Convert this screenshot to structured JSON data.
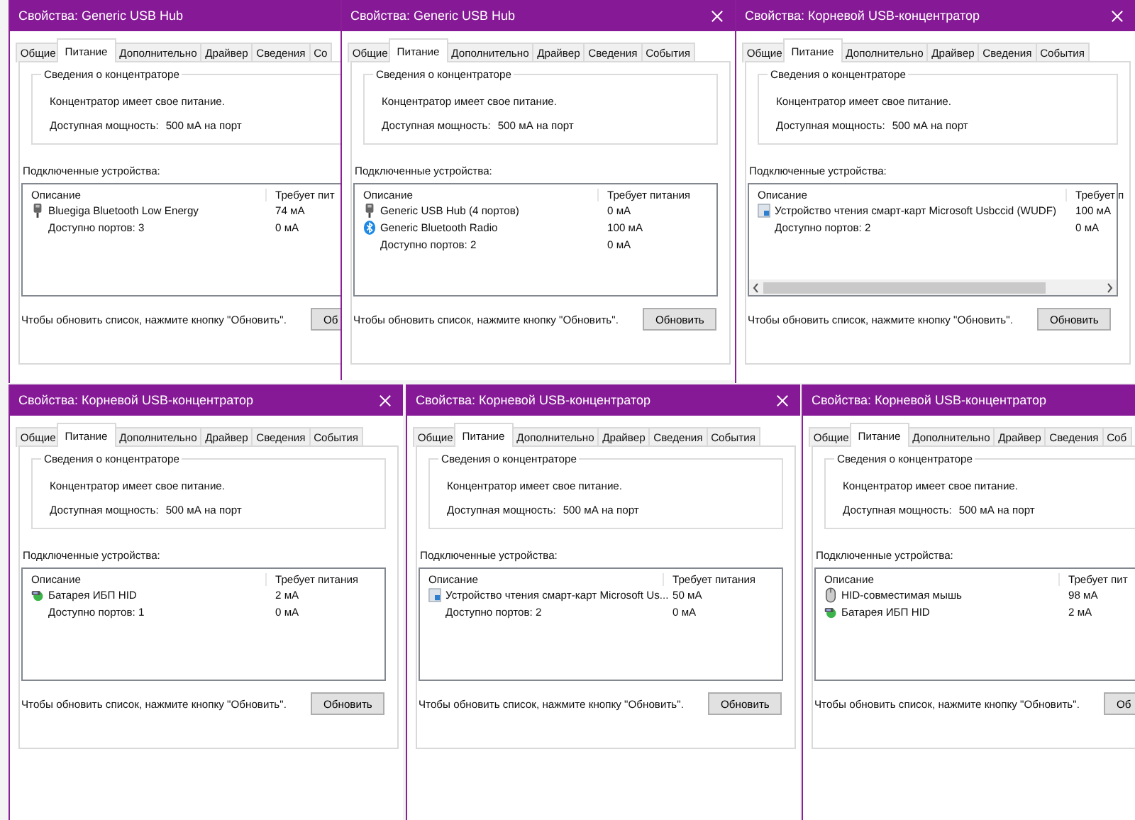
{
  "windows": [
    {
      "title": "Свойства: Generic USB Hub",
      "close_visible": false,
      "horizontal_scrollbar": false,
      "tabs": [
        {
          "label": "Общие",
          "selected": false
        },
        {
          "label": "Питание",
          "selected": true
        },
        {
          "label": "Дополнительно",
          "selected": false
        },
        {
          "label": "Драйвер",
          "selected": false
        },
        {
          "label": "Сведения",
          "selected": false
        },
        {
          "label": "Со",
          "selected": false
        }
      ],
      "hub_group": {
        "title": "Сведения о концентраторе",
        "status": "Концентратор имеет свое питание.",
        "power_label": "Доступная мощность:",
        "power_value": "500 мА на порт"
      },
      "devices_label": "Подключенные устройства:",
      "columns": [
        "Описание",
        "Требует пит"
      ],
      "devices": [
        {
          "kind": "usb",
          "description": "Bluegiga Bluetooth Low Energy",
          "power": "74 мА"
        },
        {
          "kind": "ports",
          "description": "Доступно портов: 3",
          "power": "0 мА"
        }
      ],
      "refresh_hint": "Чтобы обновить список, нажмите кнопку \"Обновить\".",
      "refresh_button": "Об"
    },
    {
      "title": "Свойства: Generic USB Hub",
      "close_visible": true,
      "horizontal_scrollbar": false,
      "tabs": [
        {
          "label": "Общие",
          "selected": false
        },
        {
          "label": "Питание",
          "selected": true
        },
        {
          "label": "Дополнительно",
          "selected": false
        },
        {
          "label": "Драйвер",
          "selected": false
        },
        {
          "label": "Сведения",
          "selected": false
        },
        {
          "label": "События",
          "selected": false
        }
      ],
      "hub_group": {
        "title": "Сведения о концентраторе",
        "status": "Концентратор имеет свое питание.",
        "power_label": "Доступная мощность:",
        "power_value": "500 мА на порт"
      },
      "devices_label": "Подключенные устройства:",
      "columns": [
        "Описание",
        "Требует питания"
      ],
      "devices": [
        {
          "kind": "usb",
          "description": "Generic USB Hub (4 портов)",
          "power": "0 мА"
        },
        {
          "kind": "bluetooth",
          "description": "Generic Bluetooth Radio",
          "power": "100 мА"
        },
        {
          "kind": "ports",
          "description": "Доступно портов: 2",
          "power": "0 мА"
        }
      ],
      "refresh_hint": "Чтобы обновить список, нажмите кнопку \"Обновить\".",
      "refresh_button": "Обновить"
    },
    {
      "title": "Свойства: Корневой USB-концентратор",
      "close_visible": true,
      "horizontal_scrollbar": true,
      "tabs": [
        {
          "label": "Общие",
          "selected": false
        },
        {
          "label": "Питание",
          "selected": true
        },
        {
          "label": "Дополнительно",
          "selected": false
        },
        {
          "label": "Драйвер",
          "selected": false
        },
        {
          "label": "Сведения",
          "selected": false
        },
        {
          "label": "События",
          "selected": false
        }
      ],
      "hub_group": {
        "title": "Сведения о концентраторе",
        "status": "Концентратор имеет свое питание.",
        "power_label": "Доступная мощность:",
        "power_value": "500 мА на порт"
      },
      "devices_label": "Подключенные устройства:",
      "columns": [
        "Описание",
        "Требует п"
      ],
      "devices": [
        {
          "kind": "smartcard",
          "description": "Устройство чтения смарт-карт Microsoft Usbccid (WUDF)",
          "power": "100 мА"
        },
        {
          "kind": "ports",
          "description": "Доступно портов: 2",
          "power": "0 мА"
        }
      ],
      "refresh_hint": "Чтобы обновить список, нажмите кнопку \"Обновить\".",
      "refresh_button": "Обновить"
    },
    {
      "title": "Свойства: Корневой USB-концентратор",
      "close_visible": true,
      "horizontal_scrollbar": false,
      "tabs": [
        {
          "label": "Общие",
          "selected": false
        },
        {
          "label": "Питание",
          "selected": true
        },
        {
          "label": "Дополнительно",
          "selected": false
        },
        {
          "label": "Драйвер",
          "selected": false
        },
        {
          "label": "Сведения",
          "selected": false
        },
        {
          "label": "События",
          "selected": false
        }
      ],
      "hub_group": {
        "title": "Сведения о концентраторе",
        "status": "Концентратор имеет свое питание.",
        "power_label": "Доступная мощность:",
        "power_value": "500 мА на порт"
      },
      "devices_label": "Подключенные устройства:",
      "columns": [
        "Описание",
        "Требует питания"
      ],
      "devices": [
        {
          "kind": "ups",
          "description": "Батарея ИБП HID",
          "power": "2 мА"
        },
        {
          "kind": "ports",
          "description": "Доступно портов: 1",
          "power": "0 мА"
        }
      ],
      "refresh_hint": "Чтобы обновить список, нажмите кнопку \"Обновить\".",
      "refresh_button": "Обновить"
    },
    {
      "title": "Свойства: Корневой USB-концентратор",
      "close_visible": true,
      "horizontal_scrollbar": false,
      "tabs": [
        {
          "label": "Общие",
          "selected": false
        },
        {
          "label": "Питание",
          "selected": true
        },
        {
          "label": "Дополнительно",
          "selected": false
        },
        {
          "label": "Драйвер",
          "selected": false
        },
        {
          "label": "Сведения",
          "selected": false
        },
        {
          "label": "События",
          "selected": false
        }
      ],
      "hub_group": {
        "title": "Сведения о концентраторе",
        "status": "Концентратор имеет свое питание.",
        "power_label": "Доступная мощность:",
        "power_value": "500 мА на порт"
      },
      "devices_label": "Подключенные устройства:",
      "columns": [
        "Описание",
        "Требует питания"
      ],
      "devices": [
        {
          "kind": "smartcard",
          "description": "Устройство чтения смарт-карт Microsoft Us...",
          "power": "50 мА"
        },
        {
          "kind": "ports",
          "description": "Доступно портов: 2",
          "power": "0 мА"
        }
      ],
      "refresh_hint": "Чтобы обновить список, нажмите кнопку \"Обновить\".",
      "refresh_button": "Обновить"
    },
    {
      "title": "Свойства: Корневой USB-концентратор",
      "close_visible": false,
      "horizontal_scrollbar": false,
      "tabs": [
        {
          "label": "Общие",
          "selected": false
        },
        {
          "label": "Питание",
          "selected": true
        },
        {
          "label": "Дополнительно",
          "selected": false
        },
        {
          "label": "Драйвер",
          "selected": false
        },
        {
          "label": "Сведения",
          "selected": false
        },
        {
          "label": "Соб",
          "selected": false
        }
      ],
      "hub_group": {
        "title": "Сведения о концентраторе",
        "status": "Концентратор имеет свое питание.",
        "power_label": "Доступная мощность:",
        "power_value": "500 мА на порт"
      },
      "devices_label": "Подключенные устройства:",
      "columns": [
        "Описание",
        "Требует пит"
      ],
      "devices": [
        {
          "kind": "mouse",
          "description": "HID-совместимая мышь",
          "power": "98 мА"
        },
        {
          "kind": "ups",
          "description": "Батарея ИБП HID",
          "power": "2 мА"
        }
      ],
      "refresh_hint": "Чтобы обновить список, нажмите кнопку \"Обновить\".",
      "refresh_button": "Об"
    }
  ]
}
